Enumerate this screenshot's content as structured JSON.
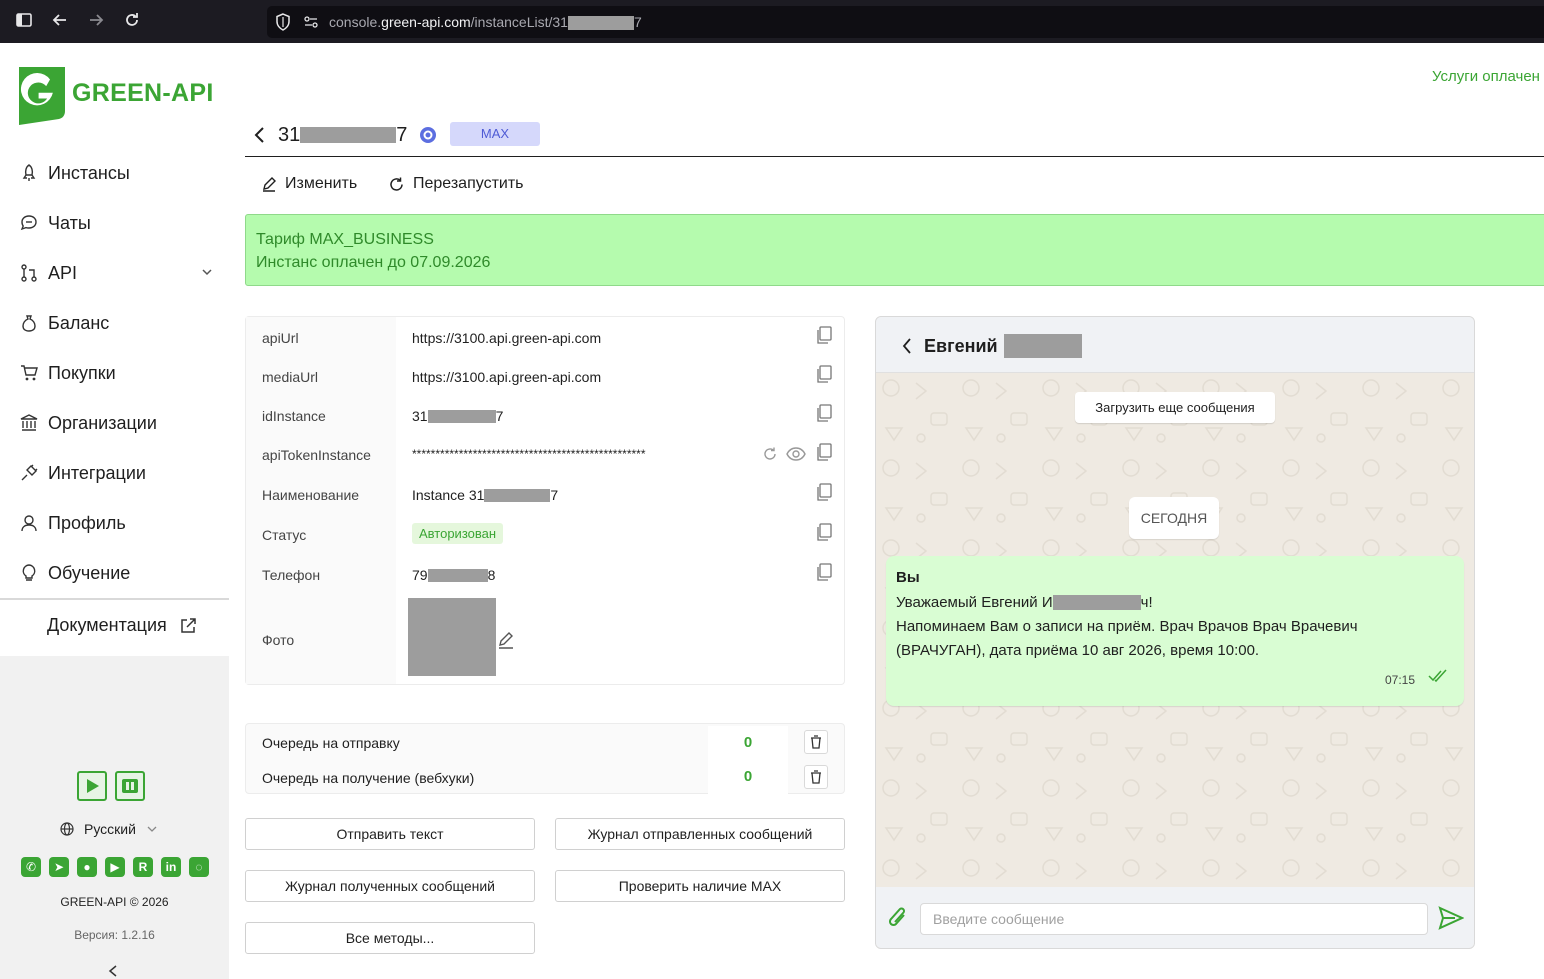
{
  "browser": {
    "url_prefix": "console.",
    "url_host": "green-api.com",
    "url_path_start": "/instanceList/31",
    "url_path_end": "7"
  },
  "sidebar": {
    "logo_text": "GREEN-API",
    "items": [
      {
        "label": "Инстансы",
        "icon": "rocket-icon"
      },
      {
        "label": "Чаты",
        "icon": "chat-icon"
      },
      {
        "label": "API",
        "icon": "api-icon"
      },
      {
        "label": "Баланс",
        "icon": "money-bag-icon"
      },
      {
        "label": "Покупки",
        "icon": "cart-icon"
      },
      {
        "label": "Организации",
        "icon": "bank-icon"
      },
      {
        "label": "Интеграции",
        "icon": "plug-icon"
      },
      {
        "label": "Профиль",
        "icon": "user-icon"
      },
      {
        "label": "Обучение",
        "icon": "bulb-icon"
      }
    ],
    "docs_label": "Документация",
    "language": "Русский",
    "copyright": "GREEN-API © 2026",
    "version": "Версия: 1.2.16",
    "social_icons": [
      "whatsapp-icon",
      "telegram-icon",
      "github-icon",
      "youtube-icon",
      "rutube-icon",
      "linkedin-icon",
      "max-icon"
    ]
  },
  "header": {
    "paid_status": "Услуги оплачен",
    "instance_prefix": "31",
    "instance_suffix": "7",
    "platform_badge": "MAX",
    "edit_label": "Изменить",
    "restart_label": "Перезапустить"
  },
  "tariff": {
    "line1": "Тариф MAX_BUSINESS",
    "line2": "Инстанс оплачен до 07.09.2026"
  },
  "info": {
    "api_url_key": "apiUrl",
    "api_url_value": "https://3100.api.green-api.com",
    "media_url_key": "mediaUrl",
    "media_url_value": "https://3100.api.green-api.com",
    "id_key": "idInstance",
    "id_prefix": "31",
    "id_suffix": "7",
    "token_key": "apiTokenInstance",
    "token_value": "**************************************************",
    "name_key": "Наименование",
    "name_prefix": "Instance 31",
    "name_suffix": "7",
    "status_key": "Статус",
    "status_value": "Авторизован",
    "phone_key": "Телефон",
    "phone_prefix": "79",
    "phone_suffix": "8",
    "photo_key": "Фото"
  },
  "queue": {
    "send_label": "Очередь на отправку",
    "send_count": "0",
    "receive_label": "Очередь на получение (вебхуки)",
    "receive_count": "0"
  },
  "buttons": {
    "send_text": "Отправить текст",
    "sent_log": "Журнал отправленных сообщений",
    "received_log": "Журнал полученных сообщений",
    "check_max": "Проверить наличие MAX",
    "all_methods": "Все методы..."
  },
  "chat": {
    "contact_name": "Евгений",
    "load_more": "Загрузить еще сообщения",
    "date_chip": "СЕГОДНЯ",
    "message": {
      "sender": "Вы",
      "line1_prefix": "Уважаемый Евгений И",
      "line1_suffix": "ч!",
      "line2": "Напоминаем Вам о записи на приём. Врач Врачов Врач Врачевич",
      "line3": "(ВРАЧУГАН), дата приёма 10 авг 2026, время 10:00.",
      "time": "07:15"
    },
    "input_placeholder": "Введите сообщение"
  },
  "colors": {
    "brand": "#3ba534",
    "tariff_bg": "#b5fbae",
    "bubble": "#d9fdd3",
    "badge_bg": "#d5d8fb"
  }
}
